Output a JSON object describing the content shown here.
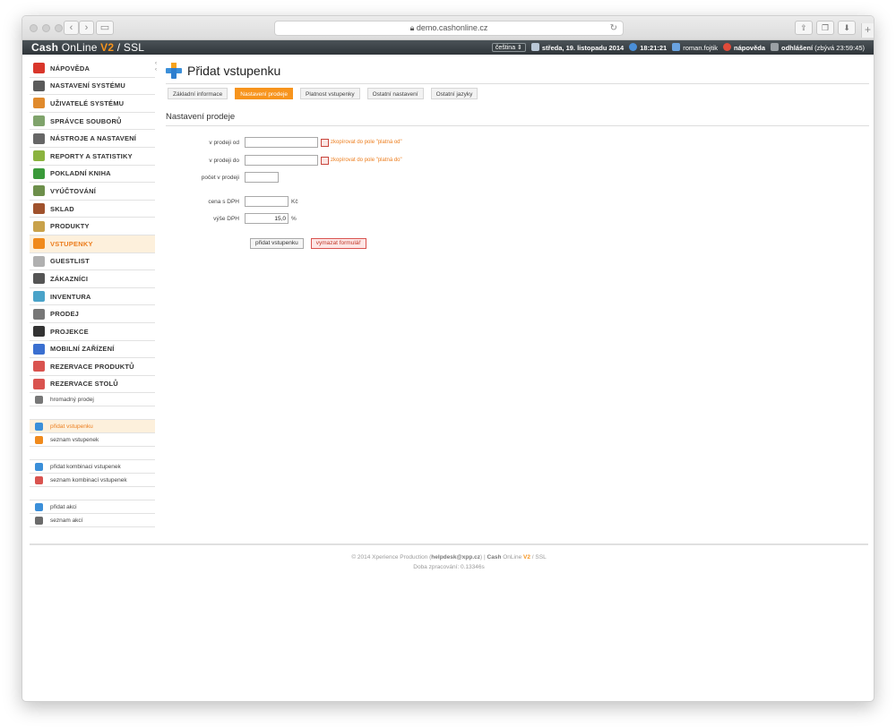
{
  "browser": {
    "url": "demo.cashonline.cz",
    "reload_icon": "reload-icon"
  },
  "app": {
    "brand_cash": "Cash",
    "brand_online": "OnLine",
    "brand_version": "V2",
    "brand_sep": "/",
    "brand_ssl": "SSL",
    "language": "čeština",
    "date": "středa, 19. listopadu 2014",
    "time": "18:21:21",
    "user": "roman.fojtik",
    "help": "nápověda",
    "logout": "odhlášení",
    "remaining": "(zbývá 23:59:45)"
  },
  "sidebar": {
    "items": [
      {
        "label": "NÁPOVĚDA",
        "icon": "help-icon",
        "color": "#d9362b"
      },
      {
        "label": "NASTAVENÍ SYSTÉMU",
        "icon": "tools-icon",
        "color": "#5a5a5a"
      },
      {
        "label": "UŽIVATELÉ SYSTÉMU",
        "icon": "users-icon",
        "color": "#e08a2c"
      },
      {
        "label": "SPRÁVCE SOUBORŮ",
        "icon": "files-icon",
        "color": "#7fa36b"
      },
      {
        "label": "NÁSTROJE A NASTAVENÍ",
        "icon": "toolbox-icon",
        "color": "#666"
      },
      {
        "label": "REPORTY A STATISTIKY",
        "icon": "chart-icon",
        "color": "#8bb33f"
      },
      {
        "label": "POKLADNÍ KNIHA",
        "icon": "book-icon",
        "color": "#3a9a3a"
      },
      {
        "label": "VYÚČTOVÁNÍ",
        "icon": "billing-icon",
        "color": "#6d8f4b"
      },
      {
        "label": "SKLAD",
        "icon": "warehouse-icon",
        "color": "#a0522d"
      },
      {
        "label": "PRODUKTY",
        "icon": "products-icon",
        "color": "#c9a24a"
      },
      {
        "label": "VSTUPENKY",
        "icon": "tickets-icon",
        "color": "#f08a1c",
        "active": true
      },
      {
        "label": "GUESTLIST",
        "icon": "guestlist-icon",
        "color": "#b0b0b0"
      },
      {
        "label": "ZÁKAZNÍCI",
        "icon": "customers-icon",
        "color": "#555"
      },
      {
        "label": "INVENTURA",
        "icon": "inventory-icon",
        "color": "#4aa3c9"
      },
      {
        "label": "PRODEJ",
        "icon": "register-icon",
        "color": "#777"
      },
      {
        "label": "PROJEKCE",
        "icon": "projection-icon",
        "color": "#333"
      },
      {
        "label": "MOBILNÍ ZAŘÍZENÍ",
        "icon": "mobile-icon",
        "color": "#3a6fd0"
      },
      {
        "label": "REZERVACE PRODUKTŮ",
        "icon": "calendar-icon",
        "color": "#d9534f"
      },
      {
        "label": "REZERVACE STOLŮ",
        "icon": "calendar-table-icon",
        "color": "#d9534f"
      }
    ],
    "sub_groups": [
      [
        {
          "label": "hromadný prodej",
          "icon": "bulk-sale-icon",
          "color": "#777"
        }
      ],
      [
        {
          "label": "přidat vstupenku",
          "icon": "add-icon",
          "color": "#3b8fd9",
          "active": true
        },
        {
          "label": "seznam vstupenek",
          "icon": "tickets-icon",
          "color": "#f08a1c"
        }
      ],
      [
        {
          "label": "přidat kombinaci vstupenek",
          "icon": "add-icon",
          "color": "#3b8fd9"
        },
        {
          "label": "seznam kombinací vstupenek",
          "icon": "combo-icon",
          "color": "#d9534f"
        }
      ],
      [
        {
          "label": "přidat akci",
          "icon": "add-icon",
          "color": "#3b8fd9"
        },
        {
          "label": "seznam akcí",
          "icon": "list-icon",
          "color": "#6b6b6b"
        }
      ]
    ]
  },
  "main": {
    "title": "Přidat vstupenku",
    "tabs": [
      {
        "label": "Základní informace"
      },
      {
        "label": "Nastavení prodeje",
        "active": true
      },
      {
        "label": "Platnost vstupenky"
      },
      {
        "label": "Ostatní nastavení"
      },
      {
        "label": "Ostatní jazyky"
      }
    ],
    "section_title": "Nastavení prodeje",
    "form": {
      "sale_from_label": "v prodeji od",
      "sale_from_value": "",
      "sale_from_copy": "zkopírovat do pole \"platná od\"",
      "sale_to_label": "v prodeji do",
      "sale_to_value": "",
      "sale_to_copy": "zkopírovat do pole \"platná do\"",
      "count_label": "počet v prodeji",
      "count_value": "",
      "price_label": "cena s DPH",
      "price_value": "",
      "price_unit": "Kč",
      "vat_label": "výše DPH",
      "vat_value": "15,0",
      "vat_unit": "%",
      "submit_label": "přidat vstupenku",
      "reset_label": "vymazat formulář"
    }
  },
  "footer": {
    "copyright": "© 2014 Xperience Production (",
    "email": "helpdesk@xpp.cz",
    "sep": ") | ",
    "brand_cash": "Cash",
    "brand_online": "OnLine",
    "brand_version": "V2",
    "brand_ssl": "/ SSL",
    "processing": "Doba zpracování: 0.13346s"
  }
}
